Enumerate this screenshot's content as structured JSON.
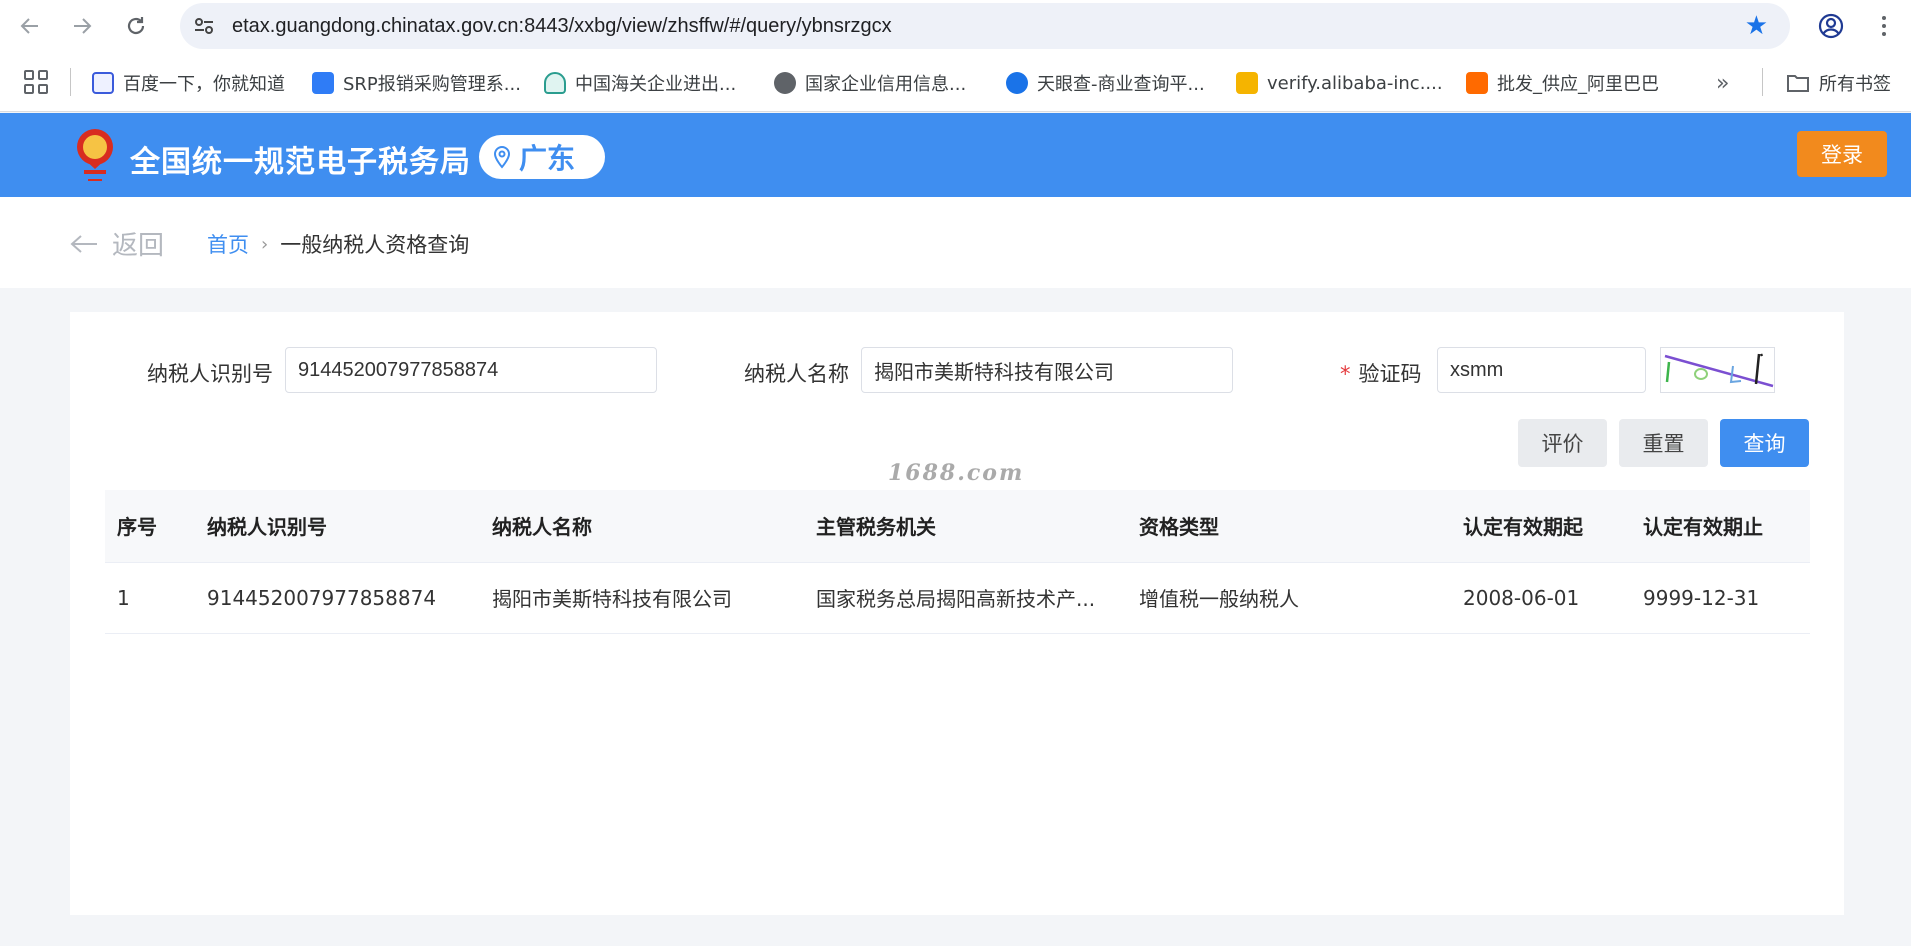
{
  "browser": {
    "url": "etax.guangdong.chinatax.gov.cn:8443/xxbg/view/zhsffw/#/query/ybnsrzgcx",
    "bookmarks": [
      {
        "label": "百度一下，你就知道",
        "icon": "baidu-icon",
        "color": "#3b5bdb"
      },
      {
        "label": "SRP报销采购管理系...",
        "icon": "srp-icon",
        "color": "#2f7cf6"
      },
      {
        "label": "中国海关企业进出...",
        "icon": "customs-icon",
        "color": "#2a9d8f"
      },
      {
        "label": "国家企业信用信息...",
        "icon": "globe-icon",
        "color": "#5f6368"
      },
      {
        "label": "天眼查-商业查询平...",
        "icon": "tianyancha-icon",
        "color": "#1a73e8"
      },
      {
        "label": "verify.alibaba-inc....",
        "icon": "alibaba-verify-icon",
        "color": "#f5b400"
      },
      {
        "label": "批发_供应_阿里巴巴",
        "icon": "alibaba-1688-icon",
        "color": "#ff6a00"
      }
    ],
    "all_bookmarks": "所有书签"
  },
  "header": {
    "title": "全国统一规范电子税务局",
    "region": "广东",
    "login": "登录"
  },
  "breadcrumb": {
    "back": "返回",
    "home": "首页",
    "current": "一般纳税人资格查询"
  },
  "form": {
    "taxpayer_id_label": "纳税人识别号",
    "taxpayer_id_value": "914452007977858874",
    "taxpayer_name_label": "纳税人名称",
    "taxpayer_name_value": "揭阳市美斯特科技有限公司",
    "captcha_required": "*",
    "captcha_label": "验证码",
    "captcha_value": "xsmm"
  },
  "buttons": {
    "evaluate": "评价",
    "reset": "重置",
    "query": "查询"
  },
  "watermark": "1688.com",
  "table": {
    "headers": [
      "序号",
      "纳税人识别号",
      "纳税人名称",
      "主管税务机关",
      "资格类型",
      "认定有效期起",
      "认定有效期止"
    ],
    "rows": [
      [
        "1",
        "914452007977858874",
        "揭阳市美斯特科技有限公司",
        "国家税务总局揭阳高新技术产...",
        "增值税一般纳税人",
        "2008-06-01",
        "9999-12-31"
      ]
    ]
  },
  "colors": {
    "header_blue": "#3f8ef0",
    "login_orange": "#f28a1d"
  }
}
